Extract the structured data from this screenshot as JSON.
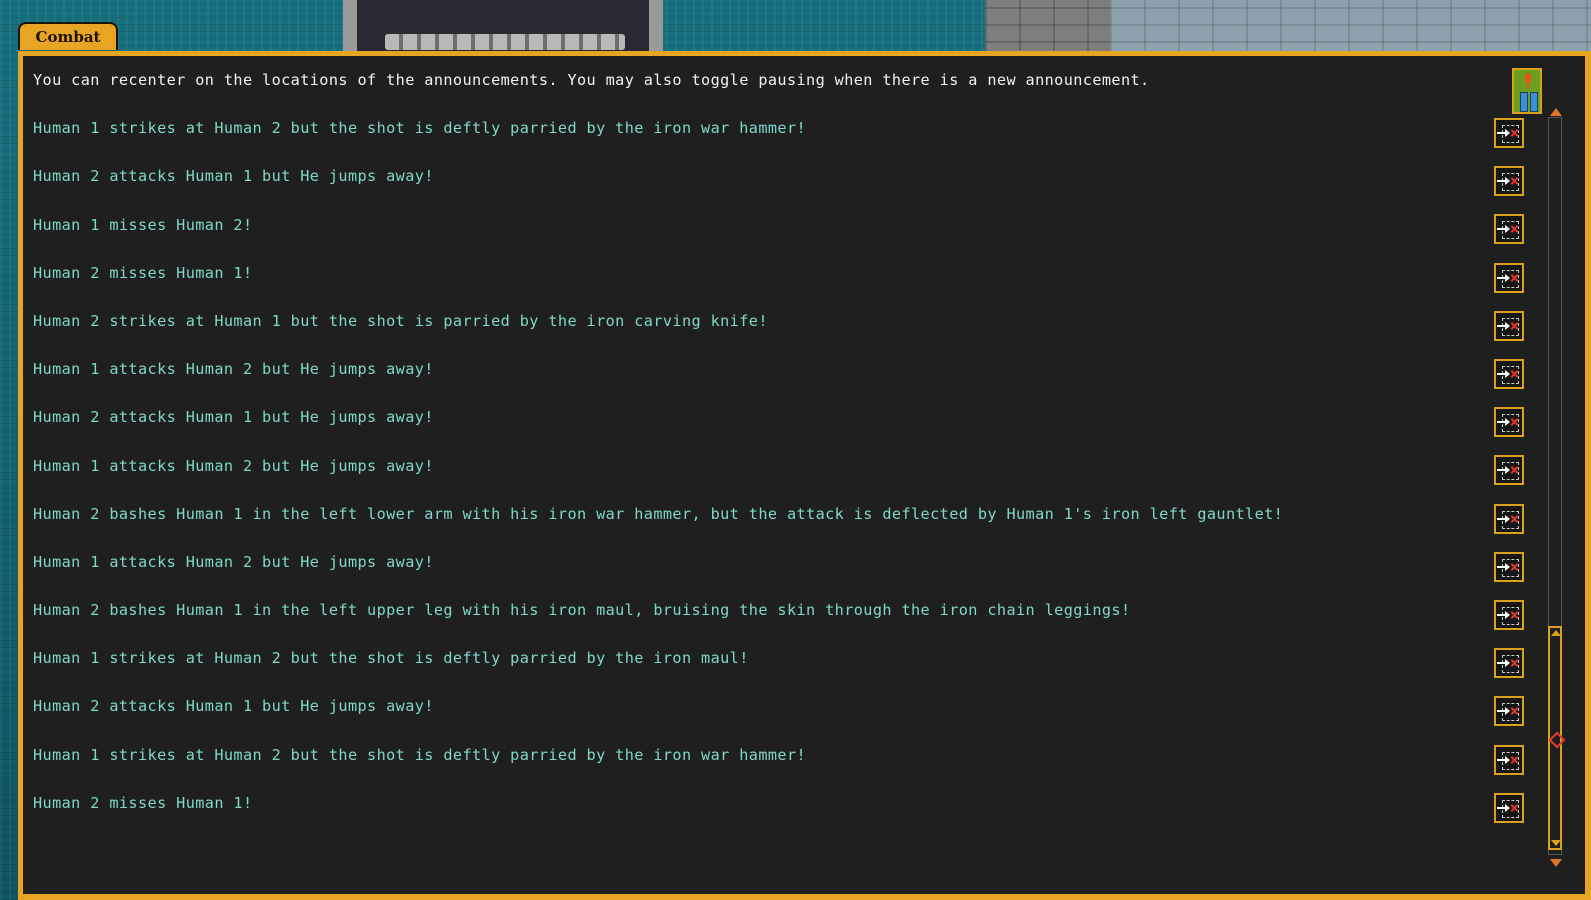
{
  "tab": {
    "label": "Combat"
  },
  "announcements": [
    {
      "text": "You can recenter on the locations of the announcements. You may also toggle pausing when there is a new announcement.",
      "kind": "info"
    },
    {
      "text": "Human 1 strikes at Human 2 but the shot is deftly parried by the iron war hammer!",
      "kind": "combat"
    },
    {
      "text": "Human 2 attacks Human 1 but He jumps away!",
      "kind": "combat"
    },
    {
      "text": "Human 1 misses Human 2!",
      "kind": "combat"
    },
    {
      "text": "Human 2 misses Human 1!",
      "kind": "combat"
    },
    {
      "text": "Human 2 strikes at Human 1 but the shot is parried by the iron carving knife!",
      "kind": "combat"
    },
    {
      "text": "Human 1 attacks Human 2 but He jumps away!",
      "kind": "combat"
    },
    {
      "text": "Human 2 attacks Human 1 but He jumps away!",
      "kind": "combat"
    },
    {
      "text": "Human 1 attacks Human 2 but He jumps away!",
      "kind": "combat"
    },
    {
      "text": "Human 2 bashes Human 1 in the left lower arm with his iron war hammer, but the attack is deflected by Human 1's iron left gauntlet!",
      "kind": "combat"
    },
    {
      "text": "Human 1 attacks Human 2 but He jumps away!",
      "kind": "combat"
    },
    {
      "text": "Human 2 bashes Human 1 in the left upper leg with his iron maul, bruising the skin through the iron chain leggings!",
      "kind": "combat"
    },
    {
      "text": "Human 1 strikes at Human 2 but the shot is deftly parried by the iron maul!",
      "kind": "combat"
    },
    {
      "text": "Human 2 attacks Human 1 but He jumps away!",
      "kind": "combat"
    },
    {
      "text": "Human 1 strikes at Human 2 but the shot is deftly parried by the iron war hammer!",
      "kind": "combat"
    },
    {
      "text": "Human 2 misses Human 1!",
      "kind": "combat"
    }
  ],
  "icons": {
    "pause_toggle": "pause-toggle-icon",
    "jump": "recenter-icon"
  },
  "colors": {
    "frame": "#e8a524",
    "panel_bg": "#1f1f1f",
    "info_text": "#f2f2f2",
    "combat_text": "#7fd8c8"
  },
  "scroll": {
    "position_fraction": 0.85
  }
}
